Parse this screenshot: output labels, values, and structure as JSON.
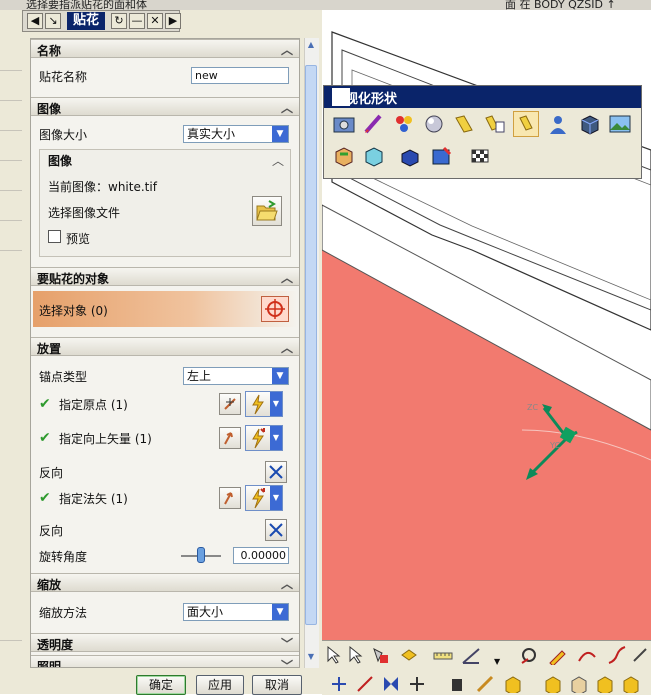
{
  "top_strip": {
    "left_text": "选择要指派贴花的面和体",
    "right_text": "面 在 BODY QZSID ↑"
  },
  "dialog": {
    "title": "贴花",
    "sections": {
      "name": {
        "header": "名称",
        "decal_name_label": "贴花名称",
        "decal_name_value": "new"
      },
      "image": {
        "header": "图像",
        "size_label": "图像大小",
        "size_value": "真实大小",
        "sub_header": "图像",
        "current_image_label": "当前图像：",
        "current_image_value": "white.tif",
        "select_file_label": "选择图像文件",
        "preview_label": "预览"
      },
      "target": {
        "header": "要贴花的对象",
        "select_label": "选择对象 (0)"
      },
      "placement": {
        "header": "放置",
        "anchor_label": "锚点类型",
        "anchor_value": "左上",
        "origin_label": "指定原点 (1)",
        "up_vector_label": "指定向上矢量 (1)",
        "reverse1_label": "反向",
        "normal_label": "指定法矢 (1)",
        "reverse2_label": "反向",
        "rotation_label": "旋转角度",
        "rotation_value": "0.00000"
      },
      "scale": {
        "header": "缩放",
        "method_label": "缩放方法",
        "method_value": "面大小"
      },
      "transparency": {
        "header": "透明度"
      },
      "lighting": {
        "header": "照明"
      }
    },
    "buttons": {
      "ok": "确定",
      "apply": "应用",
      "cancel": "取消"
    }
  },
  "palette": {
    "title": "可视化形状"
  },
  "colors": {
    "accent": "#0a246a",
    "surface": "#f27a6f",
    "selection": "#e8a070"
  }
}
